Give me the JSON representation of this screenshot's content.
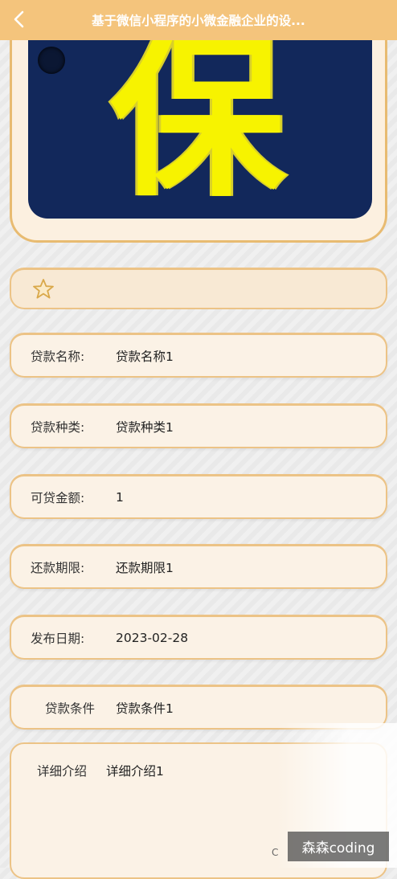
{
  "header": {
    "title": "基于微信小程序的小微金融企业的设...",
    "back_icon": "chevron-left-icon"
  },
  "banner": {
    "text": "保险",
    "colors": {
      "background": "#12285b",
      "text": "#f7f300",
      "frame": "#e8bb71"
    }
  },
  "favorite": {
    "icon": "star-outline-icon"
  },
  "fields": [
    {
      "label": "贷款名称:",
      "value": "贷款名称1"
    },
    {
      "label": "贷款种类:",
      "value": "贷款种类1"
    },
    {
      "label": "可贷金额:",
      "value": "1"
    },
    {
      "label": "还款期限:",
      "value": "还款期限1"
    },
    {
      "label": "发布日期:",
      "value": "2023-02-28"
    },
    {
      "label": "贷款条件",
      "value": "贷款条件1"
    }
  ],
  "detail": {
    "label": "详细介绍",
    "value": "详细介绍1"
  },
  "overlay": {
    "partial_char": "C",
    "watermark": "森森coding"
  },
  "colors": {
    "accent": "#f4c47c",
    "card_bg": "#fbf2e6",
    "card_border": "#ecc386"
  }
}
